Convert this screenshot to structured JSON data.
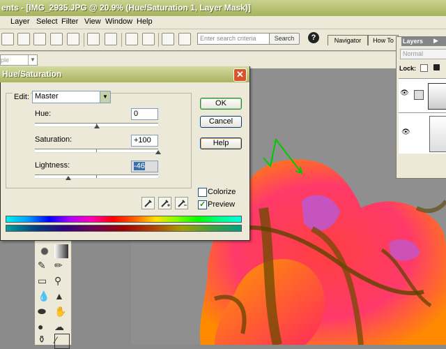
{
  "window": {
    "title": "ents - [IMG_2935.JPG @ 20.9% (Hue/Saturation 1, Layer Mask)]"
  },
  "menubar": {
    "items": [
      "Layer",
      "Select",
      "Filter",
      "View",
      "Window",
      "Help"
    ]
  },
  "toolbar": {
    "search_placeholder": "Enter search criteria",
    "search_button": "Search",
    "help_icon": "?",
    "palette_tabs": [
      "Navigator",
      "How To"
    ]
  },
  "options": {
    "mode_value": "ple"
  },
  "layers_palette": {
    "title": "Layers",
    "blend_mode": "Normal",
    "lock_label": "Lock:"
  },
  "dialog": {
    "title": "Hue/Saturation",
    "edit_label": "Edit:",
    "edit_value": "Master",
    "hue": {
      "label": "Hue:",
      "value": "0",
      "level": 0.5
    },
    "saturation": {
      "label": "Saturation:",
      "value": "+100",
      "level": 1.0
    },
    "lightness": {
      "label": "Lightness:",
      "value": "-46",
      "level": 0.27
    },
    "buttons": {
      "ok": "OK",
      "cancel": "Cancel",
      "help": "Help"
    },
    "colorize": {
      "label": "Colorize",
      "checked": false
    },
    "preview": {
      "label": "Preview",
      "checked": true
    }
  },
  "colors": {
    "titlebar": "#a7b35c",
    "dialog_bg": "#ece9d8",
    "annotation": "#00c800"
  }
}
